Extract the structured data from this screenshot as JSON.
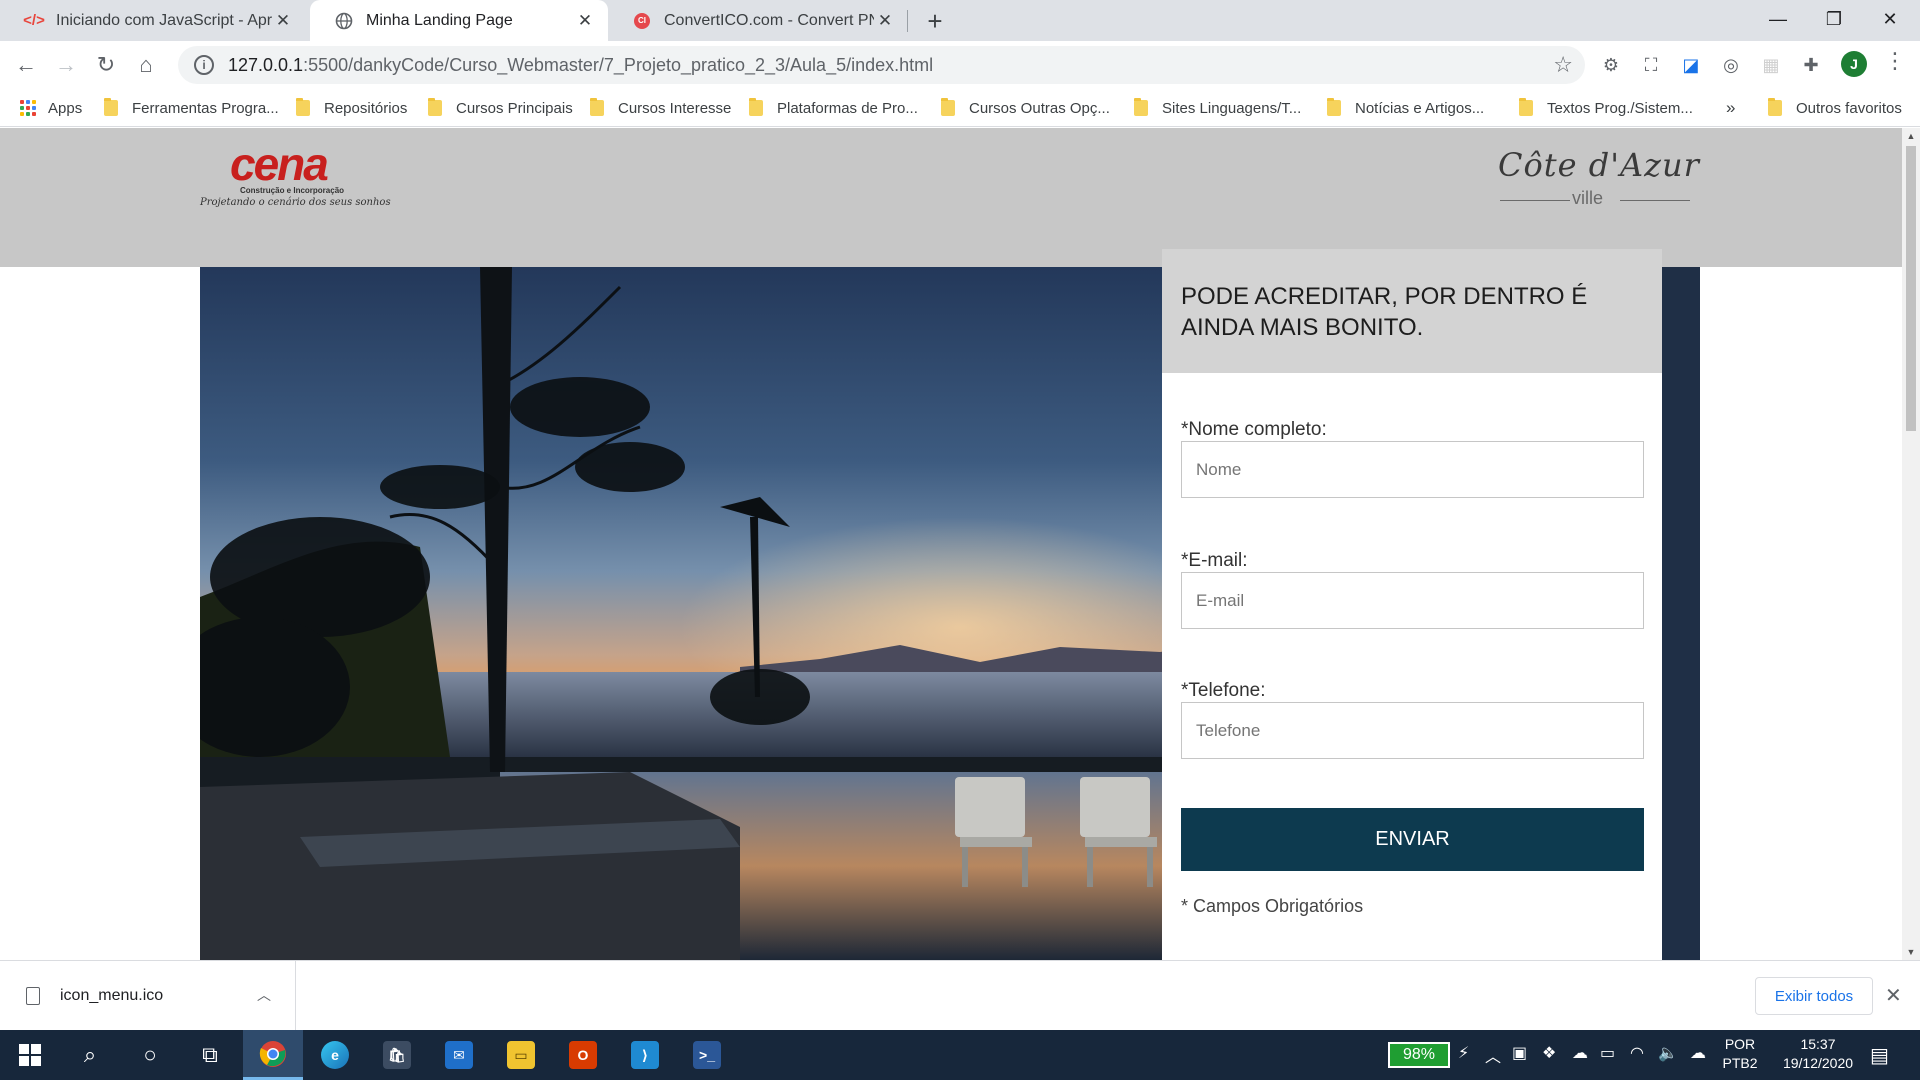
{
  "browser": {
    "tabs": [
      {
        "title": "Iniciando com JavaScript - Apres",
        "icon": "code-icon",
        "active": false
      },
      {
        "title": "Minha Landing Page",
        "icon": "globe-icon",
        "active": true
      },
      {
        "title": "ConvertICO.com - Convert PNG t",
        "icon": "converticon-icon",
        "active": false
      }
    ],
    "url_host": "127.0.0.1",
    "url_path": ":5500/dankyCode/Curso_Webmaster/7_Projeto_pratico_2_3/Aula_5/index.html",
    "profile_initial": "J",
    "bookmarks": {
      "apps": "Apps",
      "items": [
        "Ferramentas Progra...",
        "Repositórios",
        "Cursos Principais",
        "Cursos Interesse",
        "Plataformas de Pro...",
        "Cursos Outras Opç...",
        "Sites Linguagens/T...",
        "Notícias e Artigos...",
        "Textos Prog./Sistem..."
      ],
      "overflow": "»",
      "others": "Outros favoritos"
    }
  },
  "page": {
    "logo_left": {
      "word": "cena",
      "subtitle": "Construção e Incorporação",
      "tagline": "Projetando o cenário dos seus sonhos"
    },
    "logo_right": {
      "script": "Côte d'Azur",
      "sub": "ville"
    },
    "form": {
      "heading": "PODE ACREDITAR, POR DENTRO É AINDA MAIS BONITO.",
      "name_label": "*Nome completo:",
      "name_placeholder": "Nome",
      "email_label": "*E-mail:",
      "email_placeholder": "E-mail",
      "phone_label": "*Telefone:",
      "phone_placeholder": "Telefone",
      "submit": "ENVIAR",
      "note": "* Campos Obrigatórios"
    }
  },
  "downloads": {
    "file": "icon_menu.ico",
    "show_all": "Exibir todos"
  },
  "taskbar": {
    "battery": "98%",
    "lang_top": "POR",
    "lang_bottom": "PTB2",
    "time": "15:37",
    "date": "19/12/2020"
  },
  "colors": {
    "header_bg": "#c7c7c7",
    "form_head_bg": "#d3d3d3",
    "button_bg": "#0d3a4f",
    "logo_red": "#c8201e",
    "taskbar_bg": "#17273b"
  }
}
